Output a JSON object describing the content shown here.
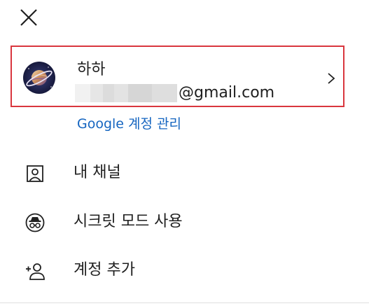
{
  "header": {
    "close_icon": "close-icon"
  },
  "account": {
    "name": "하하",
    "email_domain": "@gmail.com",
    "avatar_icon": "planet-avatar",
    "chevron_icon": "chevron-right-icon",
    "highlight_color": "#d9363e"
  },
  "manage_link": {
    "label": "Google 계정 관리",
    "color": "#1565c0"
  },
  "menu": {
    "items": [
      {
        "label": "내 채널",
        "icon": "person-box-icon"
      },
      {
        "label": "시크릿 모드 사용",
        "icon": "incognito-icon"
      },
      {
        "label": "계정 추가",
        "icon": "add-person-icon"
      }
    ]
  }
}
